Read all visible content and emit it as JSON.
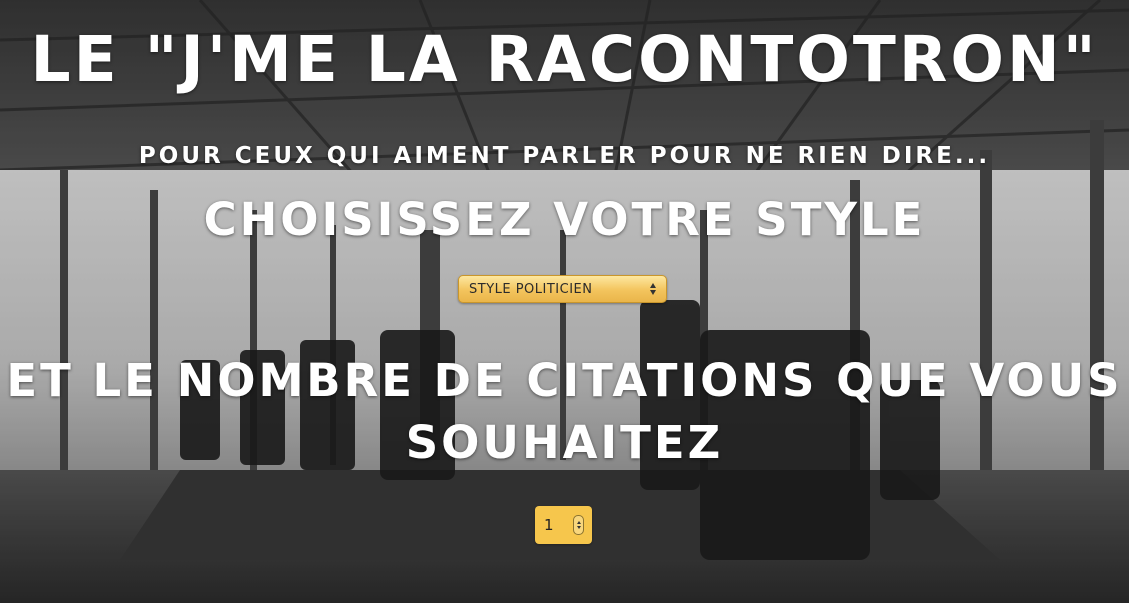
{
  "header": {
    "title": "LE \"J'ME LA RACONTOTRON\"",
    "subtitle": "POUR CEUX QUI AIMENT PARLER POUR NE RIEN DIRE..."
  },
  "style_section": {
    "heading": "CHOISISSEZ VOTRE STYLE",
    "select": {
      "selected": "STYLE POLITICIEN",
      "icon": "updown-arrows-icon",
      "color": "#f3c45d"
    }
  },
  "count_section": {
    "heading_line1": "ET LE NOMBRE DE CITATIONS QUE VOUS",
    "heading_line2": "SOUHAITEZ",
    "input": {
      "value": "1",
      "icon": "spinner-icon",
      "color": "#f6c64c"
    }
  },
  "background": {
    "description_icon": "conference-room-photo",
    "tone": "grayscale"
  }
}
